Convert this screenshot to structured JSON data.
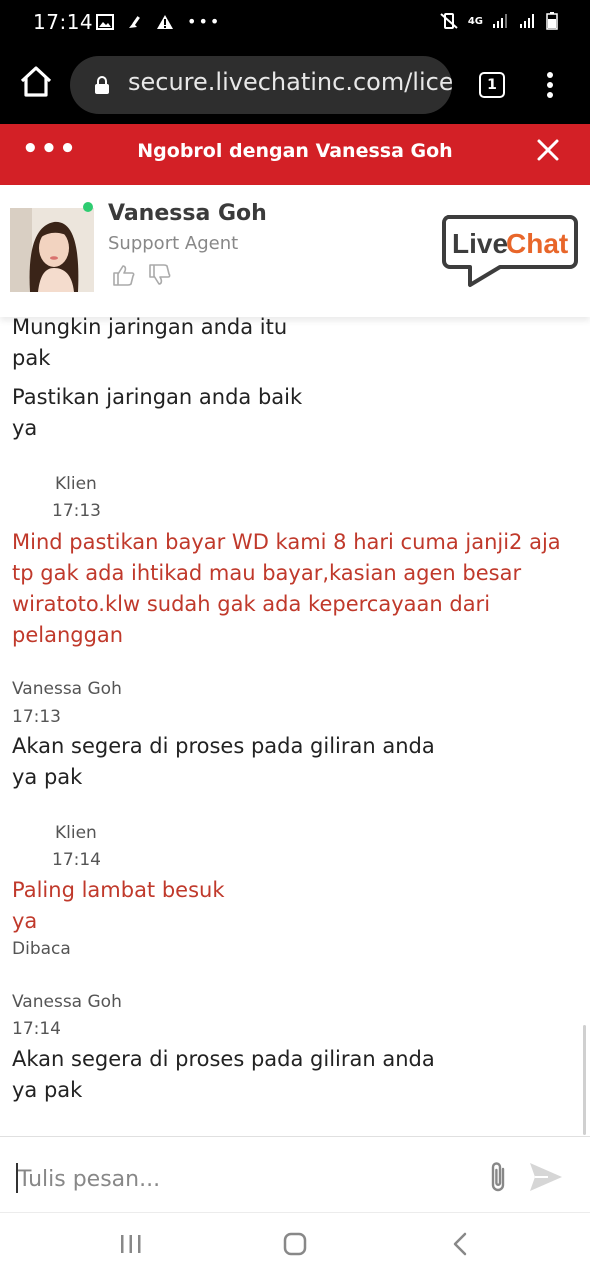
{
  "status_bar": {
    "time": "17:14",
    "network": "4G"
  },
  "browser": {
    "url": "secure.livechatinc.com/lice",
    "tab_count": "1"
  },
  "chat_header": {
    "title": "Ngobrol dengan Vanessa Goh"
  },
  "agent": {
    "name": "Vanessa Goh",
    "role": "Support Agent",
    "logo": "LiveChat",
    "status_color": "#2ecc71"
  },
  "messages": [
    {
      "line1": "Mungkin jaringan anda itu",
      "line2": "pak"
    },
    {
      "line1": "Pastikan jaringan anda baik",
      "line2": "ya"
    },
    {
      "sender": "Klien",
      "time": "17:13",
      "lines": [
        "Mind pastikan bayar WD kami 8 hari cuma janji2 aja",
        "tp gak ada ihtikad mau bayar,kasian agen besar",
        "wiratoto.klw sudah gak ada kepercayaan dari",
        "pelanggan"
      ]
    },
    {
      "sender": "Vanessa Goh",
      "time": "17:13",
      "lines": [
        "Akan segera di proses pada giliran anda",
        "ya pak"
      ]
    },
    {
      "sender": "Klien",
      "time": "17:14",
      "lines": [
        "Paling lambat besuk",
        "ya"
      ],
      "status": "Dibaca"
    },
    {
      "sender": "Vanessa Goh",
      "time": "17:14",
      "lines": [
        "Akan segera di proses pada giliran anda",
        "ya pak"
      ]
    }
  ],
  "composer": {
    "placeholder": "Tulis pesan..."
  },
  "colors": {
    "brand_red": "#d32026",
    "client_text": "#c0392b",
    "livechat_orange": "#e8662a"
  }
}
